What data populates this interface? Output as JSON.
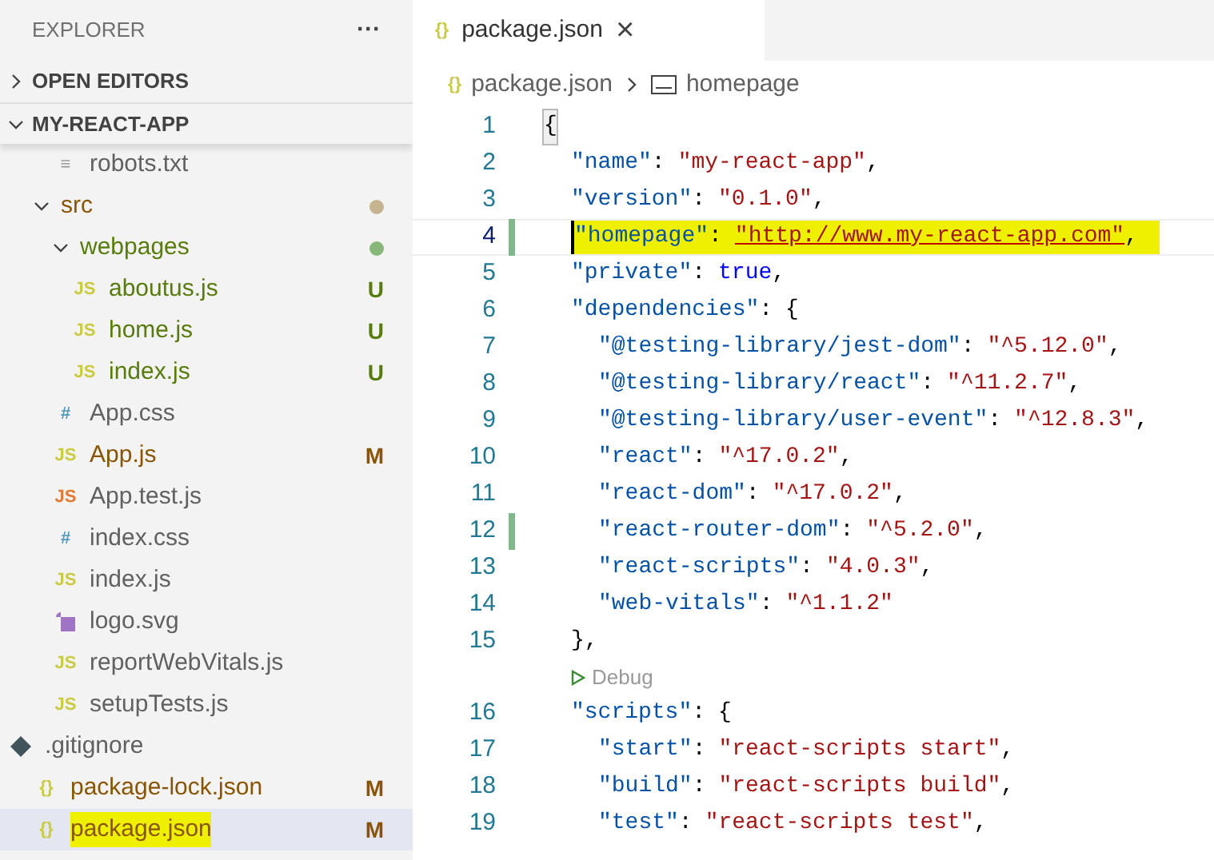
{
  "explorer": {
    "title": "EXPLORER",
    "more": "···",
    "sections": [
      {
        "label": "OPEN EDITORS",
        "expanded": false
      },
      {
        "label": "MY-REACT-APP",
        "expanded": true
      }
    ],
    "tree": [
      {
        "kind": "folder",
        "expanded": true,
        "children": [
          {
            "kind": "file",
            "glyph": {
              "text": "≡",
              "color": "#999999"
            },
            "name": "robots.txt",
            "selected": false,
            "highlighted": false
          }
        ]
      },
      {
        "kind": "folder",
        "name": "src",
        "expanded": true,
        "color": "#895503",
        "dot": {
          "color": "#c5b48f"
        },
        "children": [
          {
            "kind": "folder",
            "name": "webpages",
            "expanded": true,
            "color": "#587c0c",
            "dot": {
              "color": "#87b87a"
            },
            "children": [
              {
                "kind": "file",
                "glyph": {
                  "text": "JS",
                  "color": "#cbcb41"
                },
                "name": "aboutus.js",
                "color": "#587c0c",
                "badge": "U",
                "selected": false,
                "highlighted": false
              },
              {
                "kind": "file",
                "glyph": {
                  "text": "JS",
                  "color": "#cbcb41"
                },
                "name": "home.js",
                "color": "#587c0c",
                "badge": "U",
                "selected": false,
                "highlighted": false
              },
              {
                "kind": "file",
                "glyph": {
                  "text": "JS",
                  "color": "#cbcb41"
                },
                "name": "index.js",
                "color": "#587c0c",
                "badge": "U",
                "selected": false,
                "highlighted": false
              }
            ]
          },
          {
            "kind": "file",
            "glyph": {
              "text": "#",
              "color": "#519aba"
            },
            "name": "App.css",
            "selected": false,
            "highlighted": false
          },
          {
            "kind": "file",
            "glyph": {
              "text": "JS",
              "color": "#cbcb41"
            },
            "name": "App.js",
            "color": "#895503",
            "badge": "M",
            "selected": false,
            "highlighted": false
          },
          {
            "kind": "file",
            "glyph": {
              "text": "JS",
              "color": "#e37933"
            },
            "name": "App.test.js",
            "selected": false,
            "highlighted": false
          },
          {
            "kind": "file",
            "glyph": {
              "text": "#",
              "color": "#519aba"
            },
            "name": "index.css",
            "selected": false,
            "highlighted": false
          },
          {
            "kind": "file",
            "glyph": {
              "text": "JS",
              "color": "#cbcb41"
            },
            "name": "index.js",
            "selected": false,
            "highlighted": false
          },
          {
            "kind": "image-file",
            "name": "logo.svg",
            "selected": false,
            "highlighted": false
          },
          {
            "kind": "file",
            "glyph": {
              "text": "JS",
              "color": "#cbcb41"
            },
            "name": "reportWebVitals.js",
            "selected": false,
            "highlighted": false
          },
          {
            "kind": "file",
            "glyph": {
              "text": "JS",
              "color": "#cbcb41"
            },
            "name": "setupTests.js",
            "selected": false,
            "highlighted": false
          }
        ]
      },
      {
        "kind": "git-file",
        "name": ".gitignore",
        "selected": false,
        "highlighted": false
      },
      {
        "kind": "file",
        "glyph": {
          "text": "{}",
          "color": "#cbcb41"
        },
        "name": "package-lock.json",
        "color": "#895503",
        "badge": "M",
        "selected": false,
        "highlighted": false
      },
      {
        "kind": "file",
        "glyph": {
          "text": "{}",
          "color": "#cbcb41"
        },
        "name": "package.json",
        "color": "#895503",
        "badge": "M",
        "selected": true,
        "highlighted": true
      }
    ]
  },
  "tabs": [
    {
      "glyph": "{}",
      "label": "package.json",
      "close": "×",
      "selected": true
    }
  ],
  "breadcrumb": {
    "glyph": "{}",
    "file": "package.json",
    "symbol": "homepage"
  },
  "code": [
    {
      "kind": "code",
      "number": "1",
      "modified": false,
      "current": false,
      "highlighted": false,
      "tokens": [
        {
          "kind": "bracket",
          "text": "{"
        }
      ],
      "children": [
        {
          "kind": "code",
          "number": "2",
          "modified": false,
          "current": false,
          "highlighted": false,
          "tokens": [
            {
              "kind": "key",
              "text": "\"name\""
            },
            {
              "kind": "punct",
              "text": ":"
            },
            {
              "kind": "string",
              "text": "\"my-react-app\""
            },
            {
              "kind": "punct",
              "text": ","
            }
          ]
        },
        {
          "kind": "code",
          "number": "3",
          "modified": false,
          "current": false,
          "highlighted": false,
          "tokens": [
            {
              "kind": "key",
              "text": "\"version\""
            },
            {
              "kind": "punct",
              "text": ":"
            },
            {
              "kind": "string",
              "text": "\"0.1.0\""
            },
            {
              "kind": "punct",
              "text": ","
            }
          ]
        },
        {
          "kind": "code",
          "number": "4",
          "modified": true,
          "current": true,
          "highlighted": true,
          "tokens": [
            {
              "kind": "key",
              "text": "\"homepage\""
            },
            {
              "kind": "punct",
              "text": ":"
            },
            {
              "kind": "string",
              "text": "\"http://www.my-react-app.com\""
            },
            {
              "kind": "punct",
              "text": ","
            }
          ]
        },
        {
          "kind": "code",
          "number": "5",
          "modified": false,
          "current": false,
          "highlighted": false,
          "tokens": [
            {
              "kind": "key",
              "text": "\"private\""
            },
            {
              "kind": "punct",
              "text": ":"
            },
            {
              "kind": "bool",
              "text": "true"
            },
            {
              "kind": "punct",
              "text": ","
            }
          ]
        },
        {
          "kind": "code",
          "number": "6",
          "modified": false,
          "current": false,
          "highlighted": false,
          "tokens": [
            {
              "kind": "key",
              "text": "\"dependencies\""
            },
            {
              "kind": "punct",
              "text": ":"
            },
            {
              "kind": "bracket",
              "text": "{"
            }
          ],
          "children": [
            {
              "kind": "code",
              "number": "7",
              "modified": false,
              "current": false,
              "highlighted": false,
              "tokens": [
                {
                  "kind": "key",
                  "text": "\"@testing-library/jest-dom\""
                },
                {
                  "kind": "punct",
                  "text": ":"
                },
                {
                  "kind": "string",
                  "text": "\"^5.12.0\""
                },
                {
                  "kind": "punct",
                  "text": ","
                }
              ]
            },
            {
              "kind": "code",
              "number": "8",
              "modified": false,
              "current": false,
              "highlighted": false,
              "tokens": [
                {
                  "kind": "key",
                  "text": "\"@testing-library/react\""
                },
                {
                  "kind": "punct",
                  "text": ":"
                },
                {
                  "kind": "string",
                  "text": "\"^11.2.7\""
                },
                {
                  "kind": "punct",
                  "text": ","
                }
              ]
            },
            {
              "kind": "code",
              "number": "9",
              "modified": false,
              "current": false,
              "highlighted": false,
              "tokens": [
                {
                  "kind": "key",
                  "text": "\"@testing-library/user-event\""
                },
                {
                  "kind": "punct",
                  "text": ":"
                },
                {
                  "kind": "string",
                  "text": "\"^12.8.3\""
                },
                {
                  "kind": "punct",
                  "text": ","
                }
              ]
            },
            {
              "kind": "code",
              "number": "10",
              "modified": false,
              "current": false,
              "highlighted": false,
              "tokens": [
                {
                  "kind": "key",
                  "text": "\"react\""
                },
                {
                  "kind": "punct",
                  "text": ":"
                },
                {
                  "kind": "string",
                  "text": "\"^17.0.2\""
                },
                {
                  "kind": "punct",
                  "text": ","
                }
              ]
            },
            {
              "kind": "code",
              "number": "11",
              "modified": false,
              "current": false,
              "highlighted": false,
              "tokens": [
                {
                  "kind": "key",
                  "text": "\"react-dom\""
                },
                {
                  "kind": "punct",
                  "text": ":"
                },
                {
                  "kind": "string",
                  "text": "\"^17.0.2\""
                },
                {
                  "kind": "punct",
                  "text": ","
                }
              ]
            },
            {
              "kind": "code",
              "number": "12",
              "modified": true,
              "current": false,
              "highlighted": false,
              "tokens": [
                {
                  "kind": "key",
                  "text": "\"react-router-dom\""
                },
                {
                  "kind": "punct",
                  "text": ":"
                },
                {
                  "kind": "string",
                  "text": "\"^5.2.0\""
                },
                {
                  "kind": "punct",
                  "text": ","
                }
              ]
            },
            {
              "kind": "code",
              "number": "13",
              "modified": false,
              "current": false,
              "highlighted": false,
              "tokens": [
                {
                  "kind": "key",
                  "text": "\"react-scripts\""
                },
                {
                  "kind": "punct",
                  "text": ":"
                },
                {
                  "kind": "string",
                  "text": "\"4.0.3\""
                },
                {
                  "kind": "punct",
                  "text": ","
                }
              ]
            },
            {
              "kind": "code",
              "number": "14",
              "modified": false,
              "current": false,
              "highlighted": false,
              "tokens": [
                {
                  "kind": "key",
                  "text": "\"web-vitals\""
                },
                {
                  "kind": "punct",
                  "text": ":"
                },
                {
                  "kind": "string",
                  "text": "\"^1.1.2\""
                }
              ]
            }
          ]
        },
        {
          "kind": "code",
          "number": "15",
          "modified": false,
          "current": false,
          "highlighted": false,
          "tokens": [
            {
              "kind": "punct",
              "text": "},"
            }
          ]
        },
        {
          "kind": "codelens",
          "label": "Debug"
        },
        {
          "kind": "code",
          "number": "16",
          "modified": false,
          "current": false,
          "highlighted": false,
          "tokens": [
            {
              "kind": "key",
              "text": "\"scripts\""
            },
            {
              "kind": "punct",
              "text": ":"
            },
            {
              "kind": "bracket",
              "text": "{"
            }
          ],
          "children": [
            {
              "kind": "code",
              "number": "17",
              "modified": false,
              "current": false,
              "highlighted": false,
              "tokens": [
                {
                  "kind": "key",
                  "text": "\"start\""
                },
                {
                  "kind": "punct",
                  "text": ":"
                },
                {
                  "kind": "string",
                  "text": "\"react-scripts start\""
                },
                {
                  "kind": "punct",
                  "text": ","
                }
              ]
            },
            {
              "kind": "code",
              "number": "18",
              "modified": false,
              "current": false,
              "highlighted": false,
              "tokens": [
                {
                  "kind": "key",
                  "text": "\"build\""
                },
                {
                  "kind": "punct",
                  "text": ":"
                },
                {
                  "kind": "string",
                  "text": "\"react-scripts build\""
                },
                {
                  "kind": "punct",
                  "text": ","
                }
              ]
            },
            {
              "kind": "code",
              "number": "19",
              "modified": false,
              "current": false,
              "highlighted": false,
              "tokens": [
                {
                  "kind": "key",
                  "text": "\"test\""
                },
                {
                  "kind": "punct",
                  "text": ":"
                },
                {
                  "kind": "string",
                  "text": "\"react-scripts test\""
                },
                {
                  "kind": "punct",
                  "text": ","
                }
              ]
            }
          ]
        }
      ]
    }
  ]
}
